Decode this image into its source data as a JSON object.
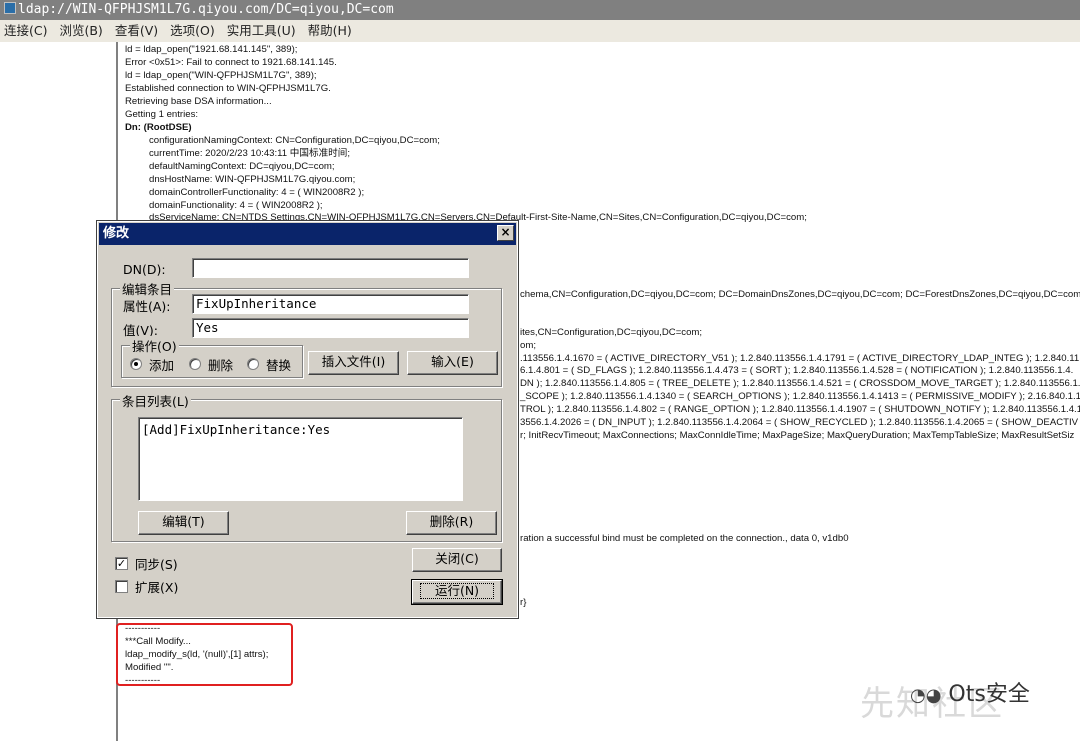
{
  "window": {
    "title": "ldap://WIN-QFPHJSM1L7G.qiyou.com/DC=qiyou,DC=com",
    "app_icon": "ldp-app-icon"
  },
  "menu": [
    "连接(C)",
    "浏览(B)",
    "查看(V)",
    "选项(O)",
    "实用工具(U)",
    "帮助(H)"
  ],
  "output": {
    "top_lines": [
      "ld = ldap_open(\"1921.68.141.145\", 389);",
      "Error <0x51>: Fail to connect to 1921.68.141.145.",
      "ld = ldap_open(\"WIN-QFPHJSM1L7G\", 389);",
      "Established connection to WIN-QFPHJSM1L7G.",
      "Retrieving base DSA information...",
      "Getting 1 entries:",
      "Dn: (RootDSE)"
    ],
    "root_dse": [
      "configurationNamingContext: CN=Configuration,DC=qiyou,DC=com;",
      "currentTime: 2020/2/23 10:43:11 中国标准时间;",
      "defaultNamingContext: DC=qiyou,DC=com;",
      "dnsHostName: WIN-QFPHJSM1L7G.qiyou.com;",
      "domainControllerFunctionality: 4 = ( WIN2008R2 );",
      "domainFunctionality: 4 = ( WIN2008R2 );",
      "dsServiceName: CN=NTDS Settings,CN=WIN-QFPHJSM1L7G,CN=Servers,CN=Default-First-Site-Name,CN=Sites,CN=Configuration,DC=qiyou,DC=com;"
    ],
    "partial_lines": [
      "chema,CN=Configuration,DC=qiyou,DC=com; DC=DomainDnsZones,DC=qiyou,DC=com; DC=ForestDnsZones,DC=qiyou,DC=com;",
      "ites,CN=Configuration,DC=qiyou,DC=com;",
      "om;",
      ".113556.1.4.1670 = ( ACTIVE_DIRECTORY_V51 ); 1.2.840.113556.1.4.1791 = ( ACTIVE_DIRECTORY_LDAP_INTEG ); 1.2.840.11",
      "6.1.4.801 = ( SD_FLAGS ); 1.2.840.113556.1.4.473 = ( SORT ); 1.2.840.113556.1.4.528 = ( NOTIFICATION ); 1.2.840.113556.1.4.",
      "DN ); 1.2.840.113556.1.4.805 = ( TREE_DELETE ); 1.2.840.113556.1.4.521 = ( CROSSDOM_MOVE_TARGET ); 1.2.840.113556.1.",
      "_SCOPE ); 1.2.840.113556.1.4.1340 = ( SEARCH_OPTIONS ); 1.2.840.113556.1.4.1413 = ( PERMISSIVE_MODIFY ); 2.16.840.1.1",
      "TROL ); 1.2.840.113556.1.4.802 = ( RANGE_OPTION ); 1.2.840.113556.1.4.1907 = ( SHUTDOWN_NOTIFY ); 1.2.840.113556.1.4.1",
      "3556.1.4.2026 = ( DN_INPUT ); 1.2.840.113556.1.4.2064 = ( SHOW_RECYCLED ); 1.2.840.113556.1.4.2065 = ( SHOW_DEACTIV",
      "r; InitRecvTimeout; MaxConnections; MaxConnIdleTime; MaxPageSize; MaxQueryDuration; MaxTempTableSize; MaxResultSetSiz",
      "ration a successful bind must be completed on the connection., data 0, v1db0",
      "r}"
    ],
    "bottom_lines": [
      "-----------",
      "***Call Modify...",
      "ldap_modify_s(ld, '(null)',[1] attrs);",
      "Modified \"\".",
      "-----------"
    ]
  },
  "dialog": {
    "title": "修改",
    "close_label": "×",
    "dn_label": "DN(D):",
    "dn_value": "",
    "edit_group_title": "编辑条目",
    "attr_label": "属性(A):",
    "attr_value": "FixUpInheritance",
    "value_label": "值(V):",
    "value_value": "Yes",
    "op_group_title": "操作(O)",
    "op_add": "添加",
    "op_delete": "删除",
    "op_replace": "替换",
    "insert_file_button": "插入文件(I)",
    "enter_button": "输入(E)",
    "list_group_title": "条目列表(L)",
    "list_items": [
      "[Add]FixUpInheritance:Yes"
    ],
    "edit_button": "编辑(T)",
    "remove_button": "删除(R)",
    "sync_label": "同步(S)",
    "sync_checked": true,
    "extend_label": "扩展(X)",
    "extend_checked": false,
    "close_button": "关闭(C)",
    "run_button": "运行(N)"
  },
  "watermark": {
    "brand": "Ots安全",
    "site": "先知社区"
  }
}
